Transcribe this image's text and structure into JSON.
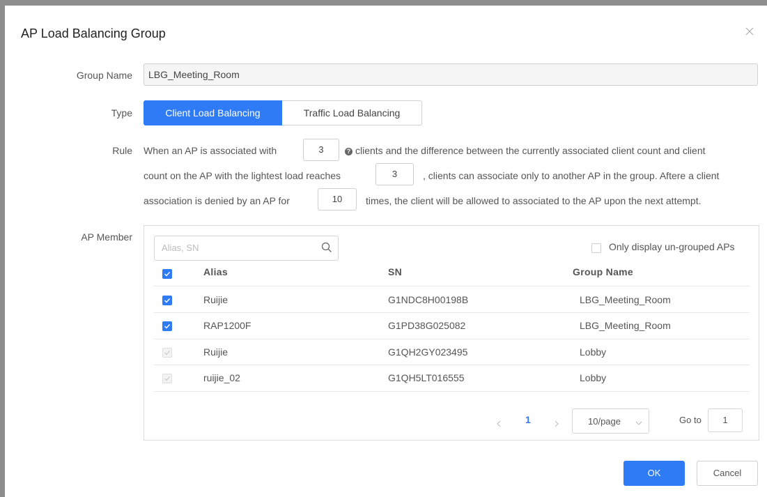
{
  "dialog": {
    "title": "AP Load Balancing Group"
  },
  "form": {
    "group_name_label": "Group Name",
    "group_name_value": "LBG_Meeting_Room",
    "type_label": "Type",
    "type_options": [
      "Client Load Balancing",
      "Traffic Load Balancing"
    ],
    "type_selected": "Client Load Balancing",
    "rule_label": "Rule",
    "rule": {
      "line1_a": "When an AP is associated with",
      "value1": "3",
      "line1_b": "clients and the difference between the currently associated client count and client",
      "line2_a": "count on the AP with the lightest load reaches",
      "value2": "3",
      "line2_b": ", clients can associate only to another AP in the group. Aftere a client",
      "line3_a": "association is denied by an AP for",
      "value3": "10",
      "line3_b": "times, the client will be allowed to associated to the AP upon the next attempt."
    },
    "member_label": "AP Member"
  },
  "members": {
    "search_placeholder": "Alias, SN",
    "filter_label": "Only display un-grouped APs",
    "columns": [
      "Alias",
      "SN",
      "Group Name"
    ],
    "rows": [
      {
        "alias": "Ruijie",
        "sn": "G1NDC8H00198B",
        "group": "LBG_Meeting_Room",
        "checked": true
      },
      {
        "alias": "RAP1200F",
        "sn": "G1PD38G025082",
        "group": "LBG_Meeting_Room",
        "checked": true
      },
      {
        "alias": "Ruijie",
        "sn": "G1QH2GY023495",
        "group": "Lobby",
        "checked": false
      },
      {
        "alias": "ruijie_02",
        "sn": "G1QH5LT016555",
        "group": "Lobby",
        "checked": false
      }
    ]
  },
  "pagination": {
    "current_page": "1",
    "page_size": "10/page",
    "goto_label": "Go to",
    "goto_value": "1"
  },
  "buttons": {
    "ok": "OK",
    "cancel": "Cancel"
  },
  "colors": {
    "accent": "#2f7bf5"
  }
}
